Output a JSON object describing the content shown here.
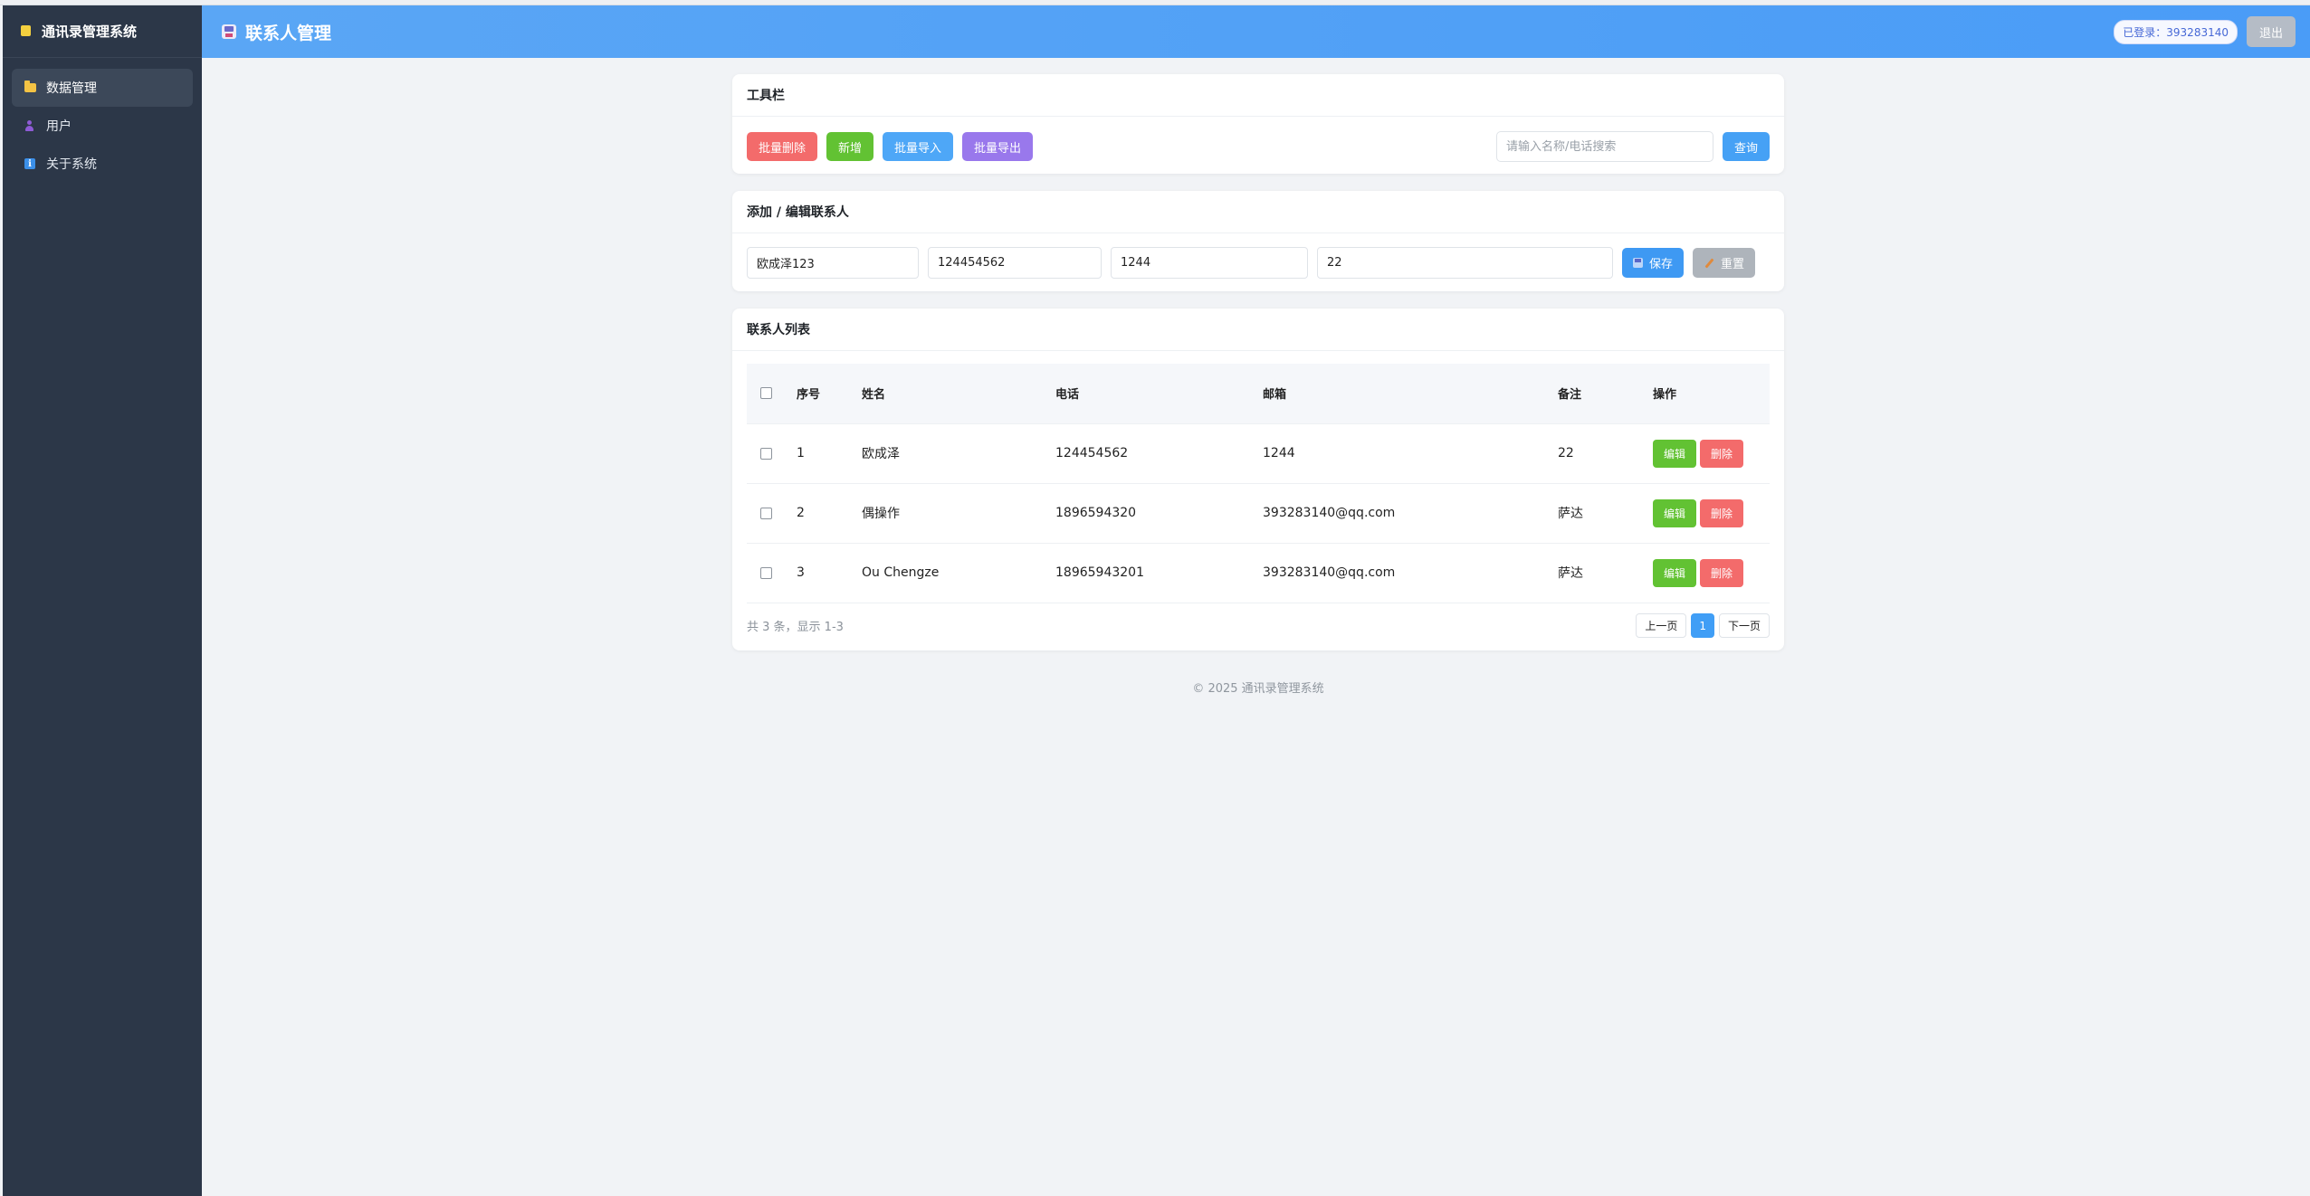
{
  "sidebar": {
    "brand": "通讯录管理系统",
    "items": [
      {
        "label": "数据管理",
        "icon": "folder-icon",
        "active": true
      },
      {
        "label": "用户",
        "icon": "user-icon",
        "active": false
      },
      {
        "label": "关于系统",
        "icon": "info-icon",
        "active": false
      }
    ]
  },
  "header": {
    "title": "联系人管理",
    "login_badge": "已登录：393283140",
    "logout_label": "退出"
  },
  "toolbar": {
    "title": "工具栏",
    "batch_delete": "批量删除",
    "add": "新增",
    "batch_import": "批量导入",
    "batch_export": "批量导出",
    "search_placeholder": "请输入名称/电话搜索",
    "search_value": "",
    "search_button": "查询"
  },
  "editor": {
    "title": "添加 / 编辑联系人",
    "name_value": "欧成泽123",
    "phone_value": "124454562",
    "email_value": "1244",
    "note_value": "22",
    "save_label": "保存",
    "reset_label": "重置"
  },
  "list": {
    "title": "联系人列表",
    "columns": [
      "序号",
      "姓名",
      "电话",
      "邮箱",
      "备注",
      "操作"
    ],
    "rows": [
      {
        "no": "1",
        "name": "欧成泽",
        "phone": "124454562",
        "email": "1244",
        "note": "22"
      },
      {
        "no": "2",
        "name": "偶操作",
        "phone": "1896594320",
        "email": "393283140@qq.com",
        "note": "萨达"
      },
      {
        "no": "3",
        "name": "Ou Chengze",
        "phone": "18965943201",
        "email": "393283140@qq.com",
        "note": "萨达"
      }
    ],
    "edit_label": "编辑",
    "delete_label": "删除",
    "summary": "共 3 条，显示 1-3",
    "prev": "上一页",
    "current_page": "1",
    "next": "下一页"
  },
  "footer": {
    "text": "© 2025 通讯录管理系统"
  },
  "colors": {
    "header": "#4a9cf7",
    "sidebar": "#2c3748",
    "danger": "#f36b6b",
    "success": "#62c233",
    "primary": "#409ef6",
    "purple": "#9978ec"
  }
}
